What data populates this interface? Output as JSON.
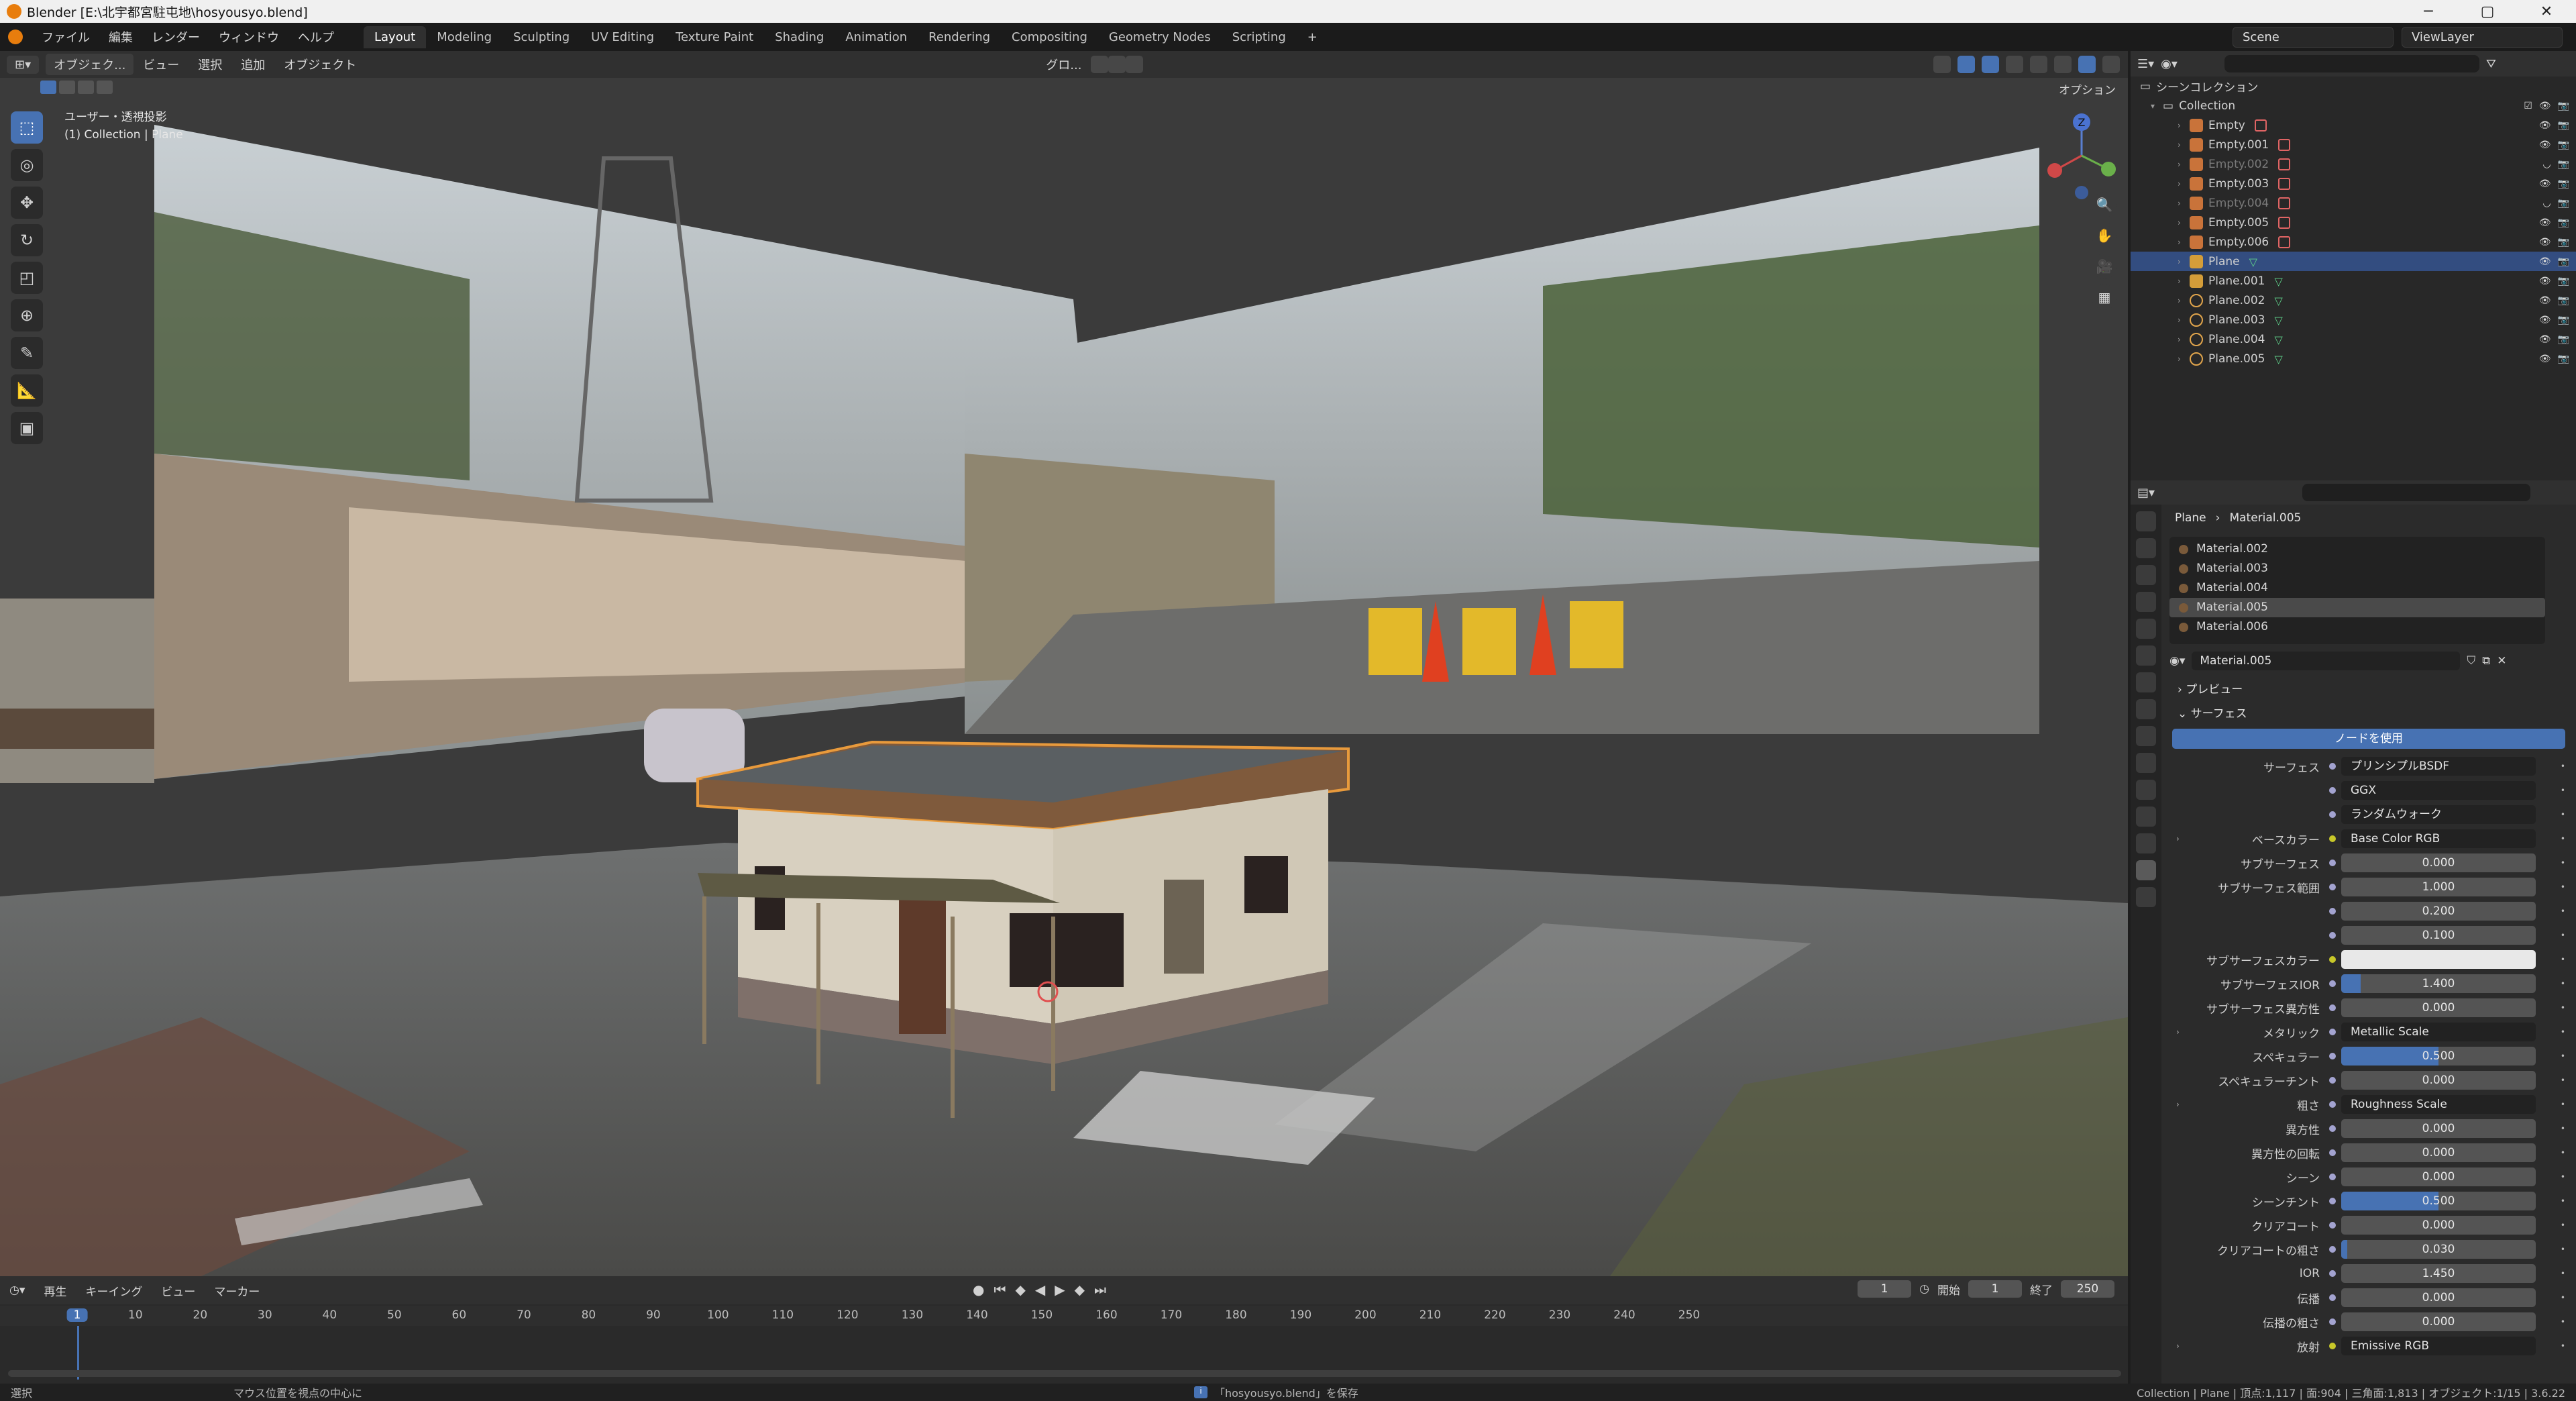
{
  "window": {
    "title": "Blender [E:\\北宇都宮駐屯地\\hosyousyo.blend]",
    "controls": [
      "─",
      "▢",
      "✕"
    ]
  },
  "menubar": {
    "menus": [
      "ファイル",
      "編集",
      "レンダー",
      "ウィンドウ",
      "ヘルプ"
    ],
    "workspaces": [
      "Layout",
      "Modeling",
      "Sculpting",
      "UV Editing",
      "Texture Paint",
      "Shading",
      "Animation",
      "Rendering",
      "Compositing",
      "Geometry Nodes",
      "Scripting",
      "+"
    ],
    "active_workspace": "Layout",
    "scene": "Scene",
    "view_layer": "ViewLayer"
  },
  "viewport": {
    "mode": "オブジェク...",
    "menus": [
      "ビュー",
      "選択",
      "追加",
      "オブジェクト"
    ],
    "transform": "グロ...",
    "options_label": "オプション",
    "overlay_line1": "ユーザー・透視投影",
    "overlay_line2": "(1) Collection | Plane",
    "gizmo_axis": "Z"
  },
  "timeline": {
    "menus": [
      "再生",
      "キーイング",
      "ビュー",
      "マーカー"
    ],
    "current_frame": "1",
    "start_label": "開始",
    "start": "1",
    "end_label": "終了",
    "end": "250",
    "ticks": [
      "1",
      "10",
      "20",
      "30",
      "40",
      "50",
      "60",
      "70",
      "80",
      "90",
      "100",
      "110",
      "120",
      "130",
      "140",
      "150",
      "160",
      "170",
      "180",
      "190",
      "200",
      "210",
      "220",
      "230",
      "240",
      "250"
    ]
  },
  "statusbar": {
    "left1": "選択",
    "left2": "マウス位置を視点の中心に",
    "center": "「hosyousyo.blend」を保存",
    "right": "Collection | Plane | 頂点:1,117 | 面:904 | 三角面:1,813 | オブジェクト:1/15 | 3.6.22"
  },
  "outliner": {
    "root": "シーンコレクション",
    "collection": "Collection",
    "items": [
      {
        "name": "Empty",
        "kind": "empty",
        "dim": false,
        "selected": false
      },
      {
        "name": "Empty.001",
        "kind": "empty",
        "dim": false,
        "selected": false
      },
      {
        "name": "Empty.002",
        "kind": "empty",
        "dim": true,
        "selected": false
      },
      {
        "name": "Empty.003",
        "kind": "empty",
        "dim": false,
        "selected": false
      },
      {
        "name": "Empty.004",
        "kind": "empty",
        "dim": true,
        "selected": false
      },
      {
        "name": "Empty.005",
        "kind": "empty",
        "dim": false,
        "selected": false
      },
      {
        "name": "Empty.006",
        "kind": "empty",
        "dim": false,
        "selected": false
      },
      {
        "name": "Plane",
        "kind": "mesh",
        "dim": false,
        "selected": true
      },
      {
        "name": "Plane.001",
        "kind": "mesh",
        "dim": false,
        "selected": false
      },
      {
        "name": "Plane.002",
        "kind": "curve",
        "dim": false,
        "selected": false
      },
      {
        "name": "Plane.003",
        "kind": "curve",
        "dim": false,
        "selected": false
      },
      {
        "name": "Plane.004",
        "kind": "curve",
        "dim": false,
        "selected": false
      },
      {
        "name": "Plane.005",
        "kind": "curve",
        "dim": false,
        "selected": false
      }
    ]
  },
  "properties": {
    "breadcrumb_object": "Plane",
    "breadcrumb_material": "Material.005",
    "material_slots": [
      "Material.002",
      "Material.003",
      "Material.004",
      "Material.005",
      "Material.006"
    ],
    "selected_slot": "Material.005",
    "material_name": "Material.005",
    "preview_panel": "プレビュー",
    "surface_panel": "サーフェス",
    "use_nodes": "ノードを使用",
    "rows": [
      {
        "label": "サーフェス",
        "value": "プリンシプルBSDF",
        "type": "link"
      },
      {
        "label": "",
        "value": "GGX",
        "type": "link"
      },
      {
        "label": "",
        "value": "ランダムウォーク",
        "type": "link"
      },
      {
        "label": "ベースカラー",
        "value": "Base Color RGB",
        "type": "link",
        "expand": true,
        "dot": "y"
      },
      {
        "label": "サブサーフェス",
        "value": "0.000",
        "type": "num"
      },
      {
        "label": "サブサーフェス範囲",
        "value": "1.000",
        "type": "num"
      },
      {
        "label": "",
        "value": "0.200",
        "type": "num"
      },
      {
        "label": "",
        "value": "0.100",
        "type": "num"
      },
      {
        "label": "サブサーフェスカラー",
        "value": "",
        "type": "white",
        "dot": "y"
      },
      {
        "label": "サブサーフェスIOR",
        "value": "1.400",
        "type": "num",
        "fill": 0.1
      },
      {
        "label": "サブサーフェス異方性",
        "value": "0.000",
        "type": "num"
      },
      {
        "label": "メタリック",
        "value": "Metallic Scale",
        "type": "link",
        "expand": true
      },
      {
        "label": "スペキュラー",
        "value": "0.500",
        "type": "num",
        "fill": 0.5
      },
      {
        "label": "スペキュラーチント",
        "value": "0.000",
        "type": "num"
      },
      {
        "label": "粗さ",
        "value": "Roughness Scale",
        "type": "link",
        "expand": true
      },
      {
        "label": "異方性",
        "value": "0.000",
        "type": "num"
      },
      {
        "label": "異方性の回転",
        "value": "0.000",
        "type": "num"
      },
      {
        "label": "シーン",
        "value": "0.000",
        "type": "num"
      },
      {
        "label": "シーンチント",
        "value": "0.500",
        "type": "num",
        "fill": 0.5
      },
      {
        "label": "クリアコート",
        "value": "0.000",
        "type": "num"
      },
      {
        "label": "クリアコートの粗さ",
        "value": "0.030",
        "type": "num",
        "fill": 0.03
      },
      {
        "label": "IOR",
        "value": "1.450",
        "type": "num"
      },
      {
        "label": "伝播",
        "value": "0.000",
        "type": "num"
      },
      {
        "label": "伝播の粗さ",
        "value": "0.000",
        "type": "num"
      },
      {
        "label": "放射",
        "value": "Emissive RGB",
        "type": "link",
        "expand": true,
        "dot": "y"
      }
    ]
  }
}
